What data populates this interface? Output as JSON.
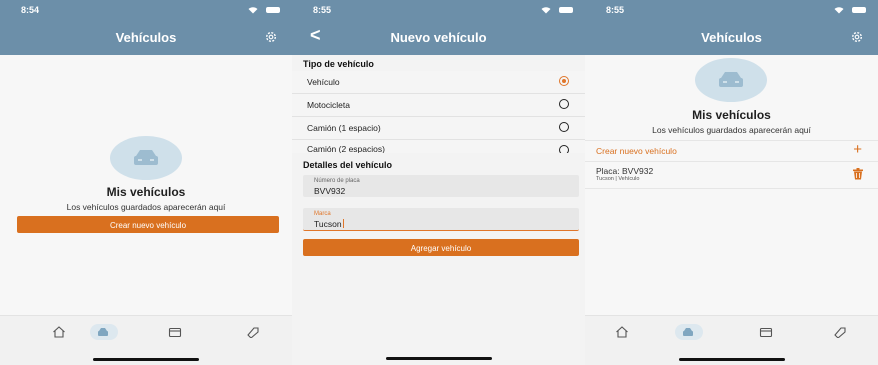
{
  "colors": {
    "header": "#6c8fa9",
    "accent": "#d9701f",
    "car_circle": "#cfe0ea",
    "active_tab": "#dde8ef"
  },
  "screen1": {
    "time": "8:54",
    "title": "Vehículos",
    "empty_title": "Mis vehículos",
    "empty_subtitle": "Los vehículos guardados aparecerán aquí",
    "create_button": "Crear nuevo vehículo",
    "icons": [
      "wifi-icon",
      "battery-icon",
      "settings-gear-icon",
      "car-icon"
    ]
  },
  "screen2": {
    "time": "8:55",
    "back": "<",
    "title": "Nuevo vehículo",
    "type_section": "Tipo de vehículo",
    "vehicle_types": [
      {
        "label": "Vehículo",
        "selected": true
      },
      {
        "label": "Motocicleta",
        "selected": false
      },
      {
        "label": "Camión (1 espacio)",
        "selected": false
      },
      {
        "label": "Camión (2 espacios)",
        "selected": false
      }
    ],
    "details_section": "Detalles del vehículo",
    "plate_label": "Número de placa",
    "plate_value": "BVV932",
    "brand_label": "Marca",
    "brand_value": "Tucson",
    "add_button": "Agregar vehículo"
  },
  "screen3": {
    "time": "8:55",
    "title": "Vehículos",
    "empty_title": "Mis vehículos",
    "empty_subtitle": "Los vehículos guardados aparecerán aquí",
    "create_label": "Crear nuevo vehículo",
    "create_plus": "+",
    "vehicle": {
      "plate": "Placa: BVV932",
      "subtitle": "Tucson | Vehículo"
    },
    "icons": [
      "trash-icon"
    ]
  },
  "tabbar": {
    "tabs": [
      "home-icon",
      "car-icon",
      "card-icon",
      "tag-icon"
    ],
    "active": "car-icon"
  }
}
